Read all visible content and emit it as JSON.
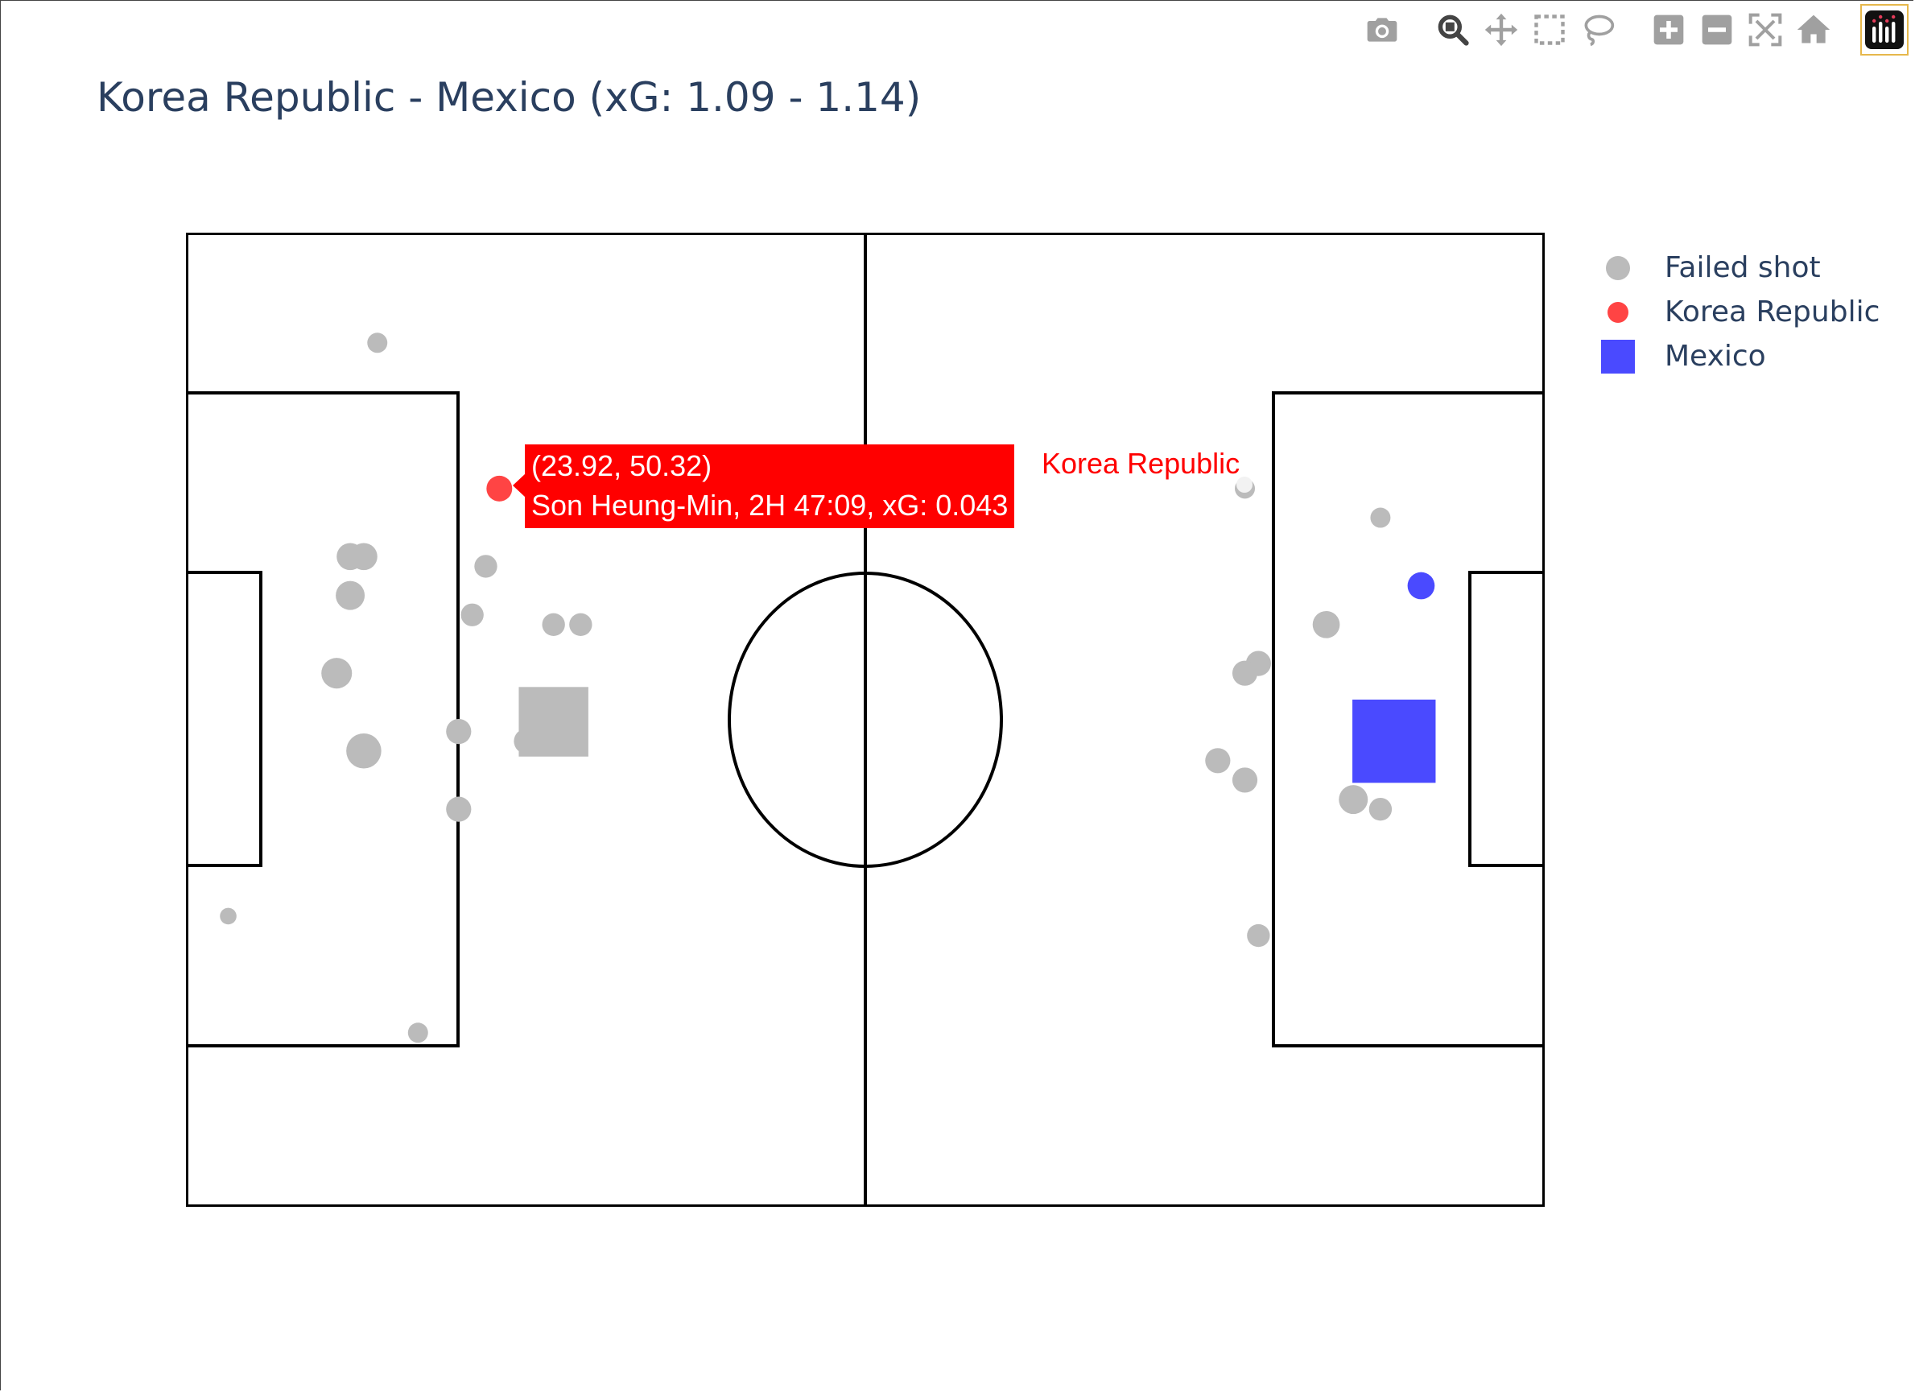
{
  "chart_data": {
    "type": "scatter",
    "title": "Korea Republic - Mexico (xG: 1.09 - 1.14)",
    "xlim": [
      0,
      120
    ],
    "ylim": [
      0,
      80
    ],
    "series": [
      {
        "name": "Failed shot",
        "color": "#bbbbbb",
        "points": [
          {
            "x": 16.8,
            "y": 71.0,
            "size": 0.02,
            "symbol": "circle"
          },
          {
            "x": 14.4,
            "y": 53.4,
            "size": 0.05,
            "symbol": "circle"
          },
          {
            "x": 15.6,
            "y": 53.4,
            "size": 0.05,
            "symbol": "circle"
          },
          {
            "x": 14.4,
            "y": 50.2,
            "size": 0.06,
            "symbol": "circle"
          },
          {
            "x": 26.4,
            "y": 52.6,
            "size": 0.03,
            "symbol": "circle"
          },
          {
            "x": 25.2,
            "y": 48.6,
            "size": 0.03,
            "symbol": "circle"
          },
          {
            "x": 32.4,
            "y": 47.8,
            "size": 0.03,
            "symbol": "circle"
          },
          {
            "x": 34.8,
            "y": 47.8,
            "size": 0.03,
            "symbol": "circle"
          },
          {
            "x": 13.2,
            "y": 43.8,
            "size": 0.07,
            "symbol": "circle"
          },
          {
            "x": 15.6,
            "y": 37.4,
            "size": 0.1,
            "symbol": "circle"
          },
          {
            "x": 24.0,
            "y": 39.0,
            "size": 0.04,
            "symbol": "circle"
          },
          {
            "x": 30.0,
            "y": 38.2,
            "size": 0.04,
            "symbol": "circle"
          },
          {
            "x": 32.4,
            "y": 39.8,
            "size": 0.44,
            "symbol": "square"
          },
          {
            "x": 24.0,
            "y": 32.6,
            "size": 0.04,
            "symbol": "circle"
          },
          {
            "x": 3.6,
            "y": 23.8,
            "size": 0.01,
            "symbol": "circle"
          },
          {
            "x": 20.4,
            "y": 14.2,
            "size": 0.02,
            "symbol": "circle"
          },
          {
            "x": 93.6,
            "y": 59.0,
            "size": 0.02,
            "symbol": "circle"
          },
          {
            "x": 105.6,
            "y": 56.6,
            "size": 0.02,
            "symbol": "circle"
          },
          {
            "x": 100.8,
            "y": 47.8,
            "size": 0.05,
            "symbol": "circle"
          },
          {
            "x": 94.8,
            "y": 44.6,
            "size": 0.04,
            "symbol": "circle"
          },
          {
            "x": 93.6,
            "y": 43.8,
            "size": 0.04,
            "symbol": "circle"
          },
          {
            "x": 91.2,
            "y": 36.6,
            "size": 0.04,
            "symbol": "circle"
          },
          {
            "x": 93.6,
            "y": 35.0,
            "size": 0.04,
            "symbol": "circle"
          },
          {
            "x": 103.2,
            "y": 33.4,
            "size": 0.06,
            "symbol": "circle"
          },
          {
            "x": 105.6,
            "y": 32.6,
            "size": 0.03,
            "symbol": "circle"
          },
          {
            "x": 94.8,
            "y": 22.2,
            "size": 0.03,
            "symbol": "circle"
          }
        ]
      },
      {
        "name": "Korea Republic",
        "color": "#ff4444",
        "points": [
          {
            "x": 27.6,
            "y": 59.0,
            "size": 0.043,
            "symbol": "circle"
          }
        ]
      },
      {
        "name": "Mexico",
        "color": "#4a4aff",
        "points": [
          {
            "x": 109.2,
            "y": 51.0,
            "size": 0.05,
            "symbol": "circle"
          },
          {
            "x": 106.8,
            "y": 38.2,
            "size": 0.82,
            "symbol": "square"
          }
        ]
      }
    ],
    "hover": {
      "coords": "(23.92, 50.32)",
      "text": "Son Heung-Min, 2H 47:09, xG: 0.043",
      "series": "Korea Republic"
    },
    "legend_position": "top-right"
  },
  "legend": [
    {
      "label": "Failed shot",
      "color": "#bbbbbb",
      "symbol": "circle"
    },
    {
      "label": "Korea Republic",
      "color": "#ff4444",
      "symbol": "circle"
    },
    {
      "label": "Mexico",
      "color": "#4a4aff",
      "symbol": "square"
    }
  ],
  "modebar": {
    "icons": [
      "camera-icon",
      "zoom-icon",
      "pan-icon",
      "box-select-icon",
      "lasso-icon",
      "zoom-in-icon",
      "zoom-out-icon",
      "autoscale-icon",
      "reset-axes-icon",
      "plotly-logo-icon"
    ],
    "inactive_color": "#a0a0a0",
    "active_color": "#444444"
  }
}
